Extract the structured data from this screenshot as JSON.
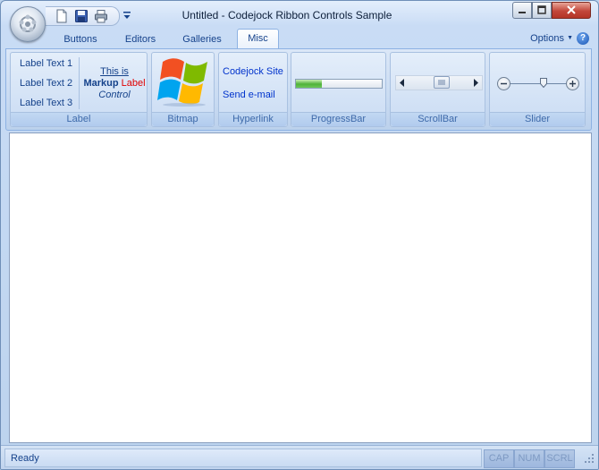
{
  "window": {
    "title": "Untitled - Codejock Ribbon Controls Sample"
  },
  "quick_access": {
    "icons": [
      "new-document-icon",
      "save-icon",
      "print-icon",
      "customize-dropdown-icon"
    ]
  },
  "tabs": [
    {
      "label": "Buttons",
      "active": false
    },
    {
      "label": "Editors",
      "active": false
    },
    {
      "label": "Galleries",
      "active": false
    },
    {
      "label": "Misc",
      "active": true
    }
  ],
  "options": {
    "label": "Options",
    "help_label": "?"
  },
  "ribbon": {
    "label_group": {
      "caption": "Label",
      "items": [
        "Label Text 1",
        "Label Text 2",
        "Label Text 3"
      ],
      "markup": {
        "line1": "This is",
        "bold": "Markup",
        "red": "Label",
        "italic": "Control"
      }
    },
    "bitmap_group": {
      "caption": "Bitmap",
      "image": "windows-logo"
    },
    "hyperlink_group": {
      "caption": "Hyperlink",
      "links": [
        "Codejock Site",
        "Send e-mail"
      ]
    },
    "progress_group": {
      "caption": "ProgressBar",
      "progress_percent": 30
    },
    "scroll_group": {
      "caption": "ScrollBar",
      "position_percent": 55
    },
    "slider_group": {
      "caption": "Slider",
      "position_percent": 60
    }
  },
  "status": {
    "text": "Ready",
    "panes": [
      "CAP",
      "NUM",
      "SCRL"
    ]
  }
}
